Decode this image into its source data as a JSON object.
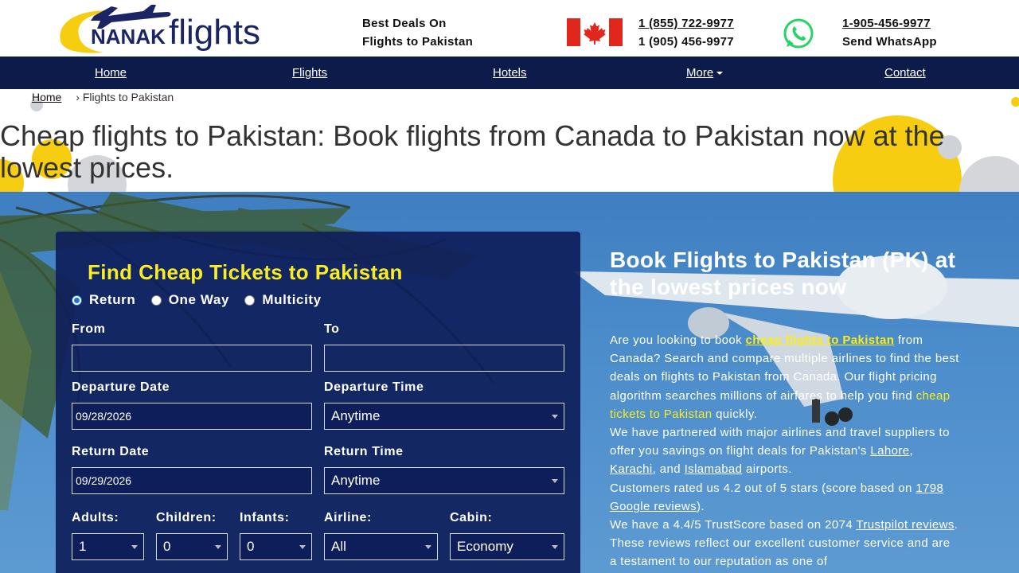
{
  "header": {
    "logo_text_nanak": "NANAK",
    "logo_text_flights": "flights",
    "tagline_line1": "Best Deals On",
    "tagline_line2": "Flights to Pakistan",
    "phone_tollfree": "1 (855) 722-9977",
    "phone_local": "1 (905) 456-9977",
    "whatsapp_number": "1-905-456-9977",
    "whatsapp_label": "Send WhatsApp"
  },
  "nav": {
    "home": "Home",
    "flights": "Flights",
    "hotels": "Hotels",
    "more": "More",
    "contact": "Contact"
  },
  "breadcrumb": {
    "home": "Home",
    "separator": "›",
    "current": "Flights to Pakistan"
  },
  "page_title": "Cheap flights to Pakistan: Book flights from Canada to Pakistan now at the lowest prices.",
  "search": {
    "title": "Find Cheap Tickets to Pakistan",
    "trip_types": [
      {
        "label": "Return",
        "selected": true
      },
      {
        "label": "One Way",
        "selected": false
      },
      {
        "label": "Multicity",
        "selected": false
      }
    ],
    "from_label": "From",
    "from_value": "",
    "to_label": "To",
    "to_value": "",
    "departure_date_label": "Departure Date",
    "departure_date": "09/28/2026",
    "departure_time_label": "Departure Time",
    "departure_time": "Anytime",
    "return_date_label": "Return Date",
    "return_date": "09/29/2026",
    "return_time_label": "Return Time",
    "return_time": "Anytime",
    "adults_label": "Adults:",
    "adults": "1",
    "children_label": "Children:",
    "children": "0",
    "infants_label": "Infants:",
    "infants": "0",
    "airline_label": "Airline:",
    "airline": "All",
    "cabin_label": "Cabin:",
    "cabin": "Economy"
  },
  "info": {
    "title": "Book Flights to Pakistan (PK) at the lowest prices now",
    "p1_a": "Are you looking to book ",
    "p1_link": "cheap flights to Pakistan",
    "p1_b": " from Canada? Search and compare multiple airlines to find the best deals on flights to Pakistan from Canada. Our flight pricing algorithm searches millions of airfares to help you find ",
    "p1_hl": "cheap tickets to Pakistan",
    "p1_c": " quickly.",
    "p2_a": "We have partnered with major airlines and travel suppliers to offer you savings on flight deals for Pakistan's ",
    "p2_lahore": "Lahore",
    "p2_comma": ", ",
    "p2_karachi": "Karachi",
    "p2_and": ", and ",
    "p2_islamabad": "Islamabad",
    "p2_b": " airports.",
    "p3_a": "Customers rated us 4.2 out of 5 stars (score based on ",
    "p3_link": "1798 Google reviews",
    "p3_b": ").",
    "p4_a": "We have a 4.4/5 TrustScore based on 2074 ",
    "p4_link": "Trustpilot reviews",
    "p4_b": ". These reviews reflect our excellent customer service and are a testament to our reputation as one of"
  },
  "colors": {
    "navy": "#0d1b4b",
    "panel": "#0e1e5a",
    "accent_yellow": "#f9ec1f",
    "canada_red": "#e1261c",
    "whatsapp_green": "#25d366"
  },
  "icons": [
    "nanak-flights-logo",
    "canada-flag-icon",
    "whatsapp-icon",
    "caret-down-icon",
    "select-arrow-icon"
  ]
}
